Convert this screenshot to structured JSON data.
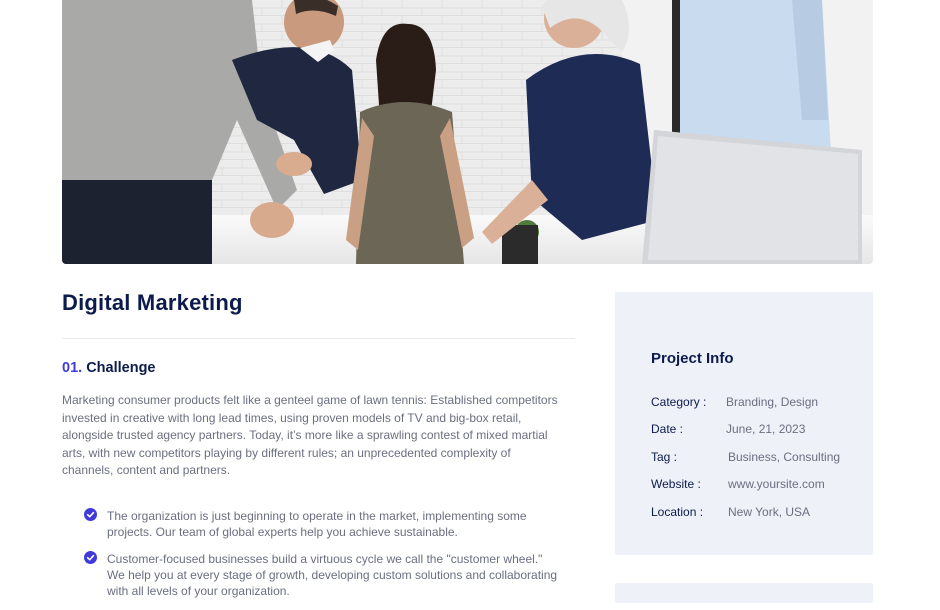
{
  "project": {
    "title": "Digital Marketing",
    "challenge_number": "01.",
    "challenge_title": "Challenge",
    "description": "Marketing consumer products felt like a genteel game of lawn tennis: Established competitors invested in creative with long lead times, using proven models of TV and big-box retail, alongside trusted agency partners. Today, it’s more like a sprawling contest of mixed martial arts, with new competitors playing by different rules; an unprecedented complexity of channels, content and partners.",
    "bullets": [
      "The organization is just beginning to operate in the market, implementing some projects. Our team of global experts help you achieve sustainable.",
      "Customer-focused businesses build a virtuous cycle we call the \"customer wheel.\" We help you at every stage of growth, developing custom solutions and collaborating with all levels of your organization."
    ]
  },
  "project_info": {
    "heading": "Project Info",
    "rows": [
      {
        "label": "Category :",
        "value": "Branding, Design"
      },
      {
        "label": "Date :",
        "value": "June, 21, 2023"
      },
      {
        "label": "Tag :",
        "value": "Business, Consulting"
      },
      {
        "label": "Website :",
        "value": "www.yoursite.com"
      },
      {
        "label": "Location :",
        "value": "New York, USA"
      }
    ]
  },
  "colors": {
    "accent": "#3f3bdb",
    "heading": "#0d1b4c",
    "body_text": "#6b6f80",
    "card_bg": "#eef1f8"
  },
  "icons": {
    "bullet": "check-circle-icon"
  }
}
